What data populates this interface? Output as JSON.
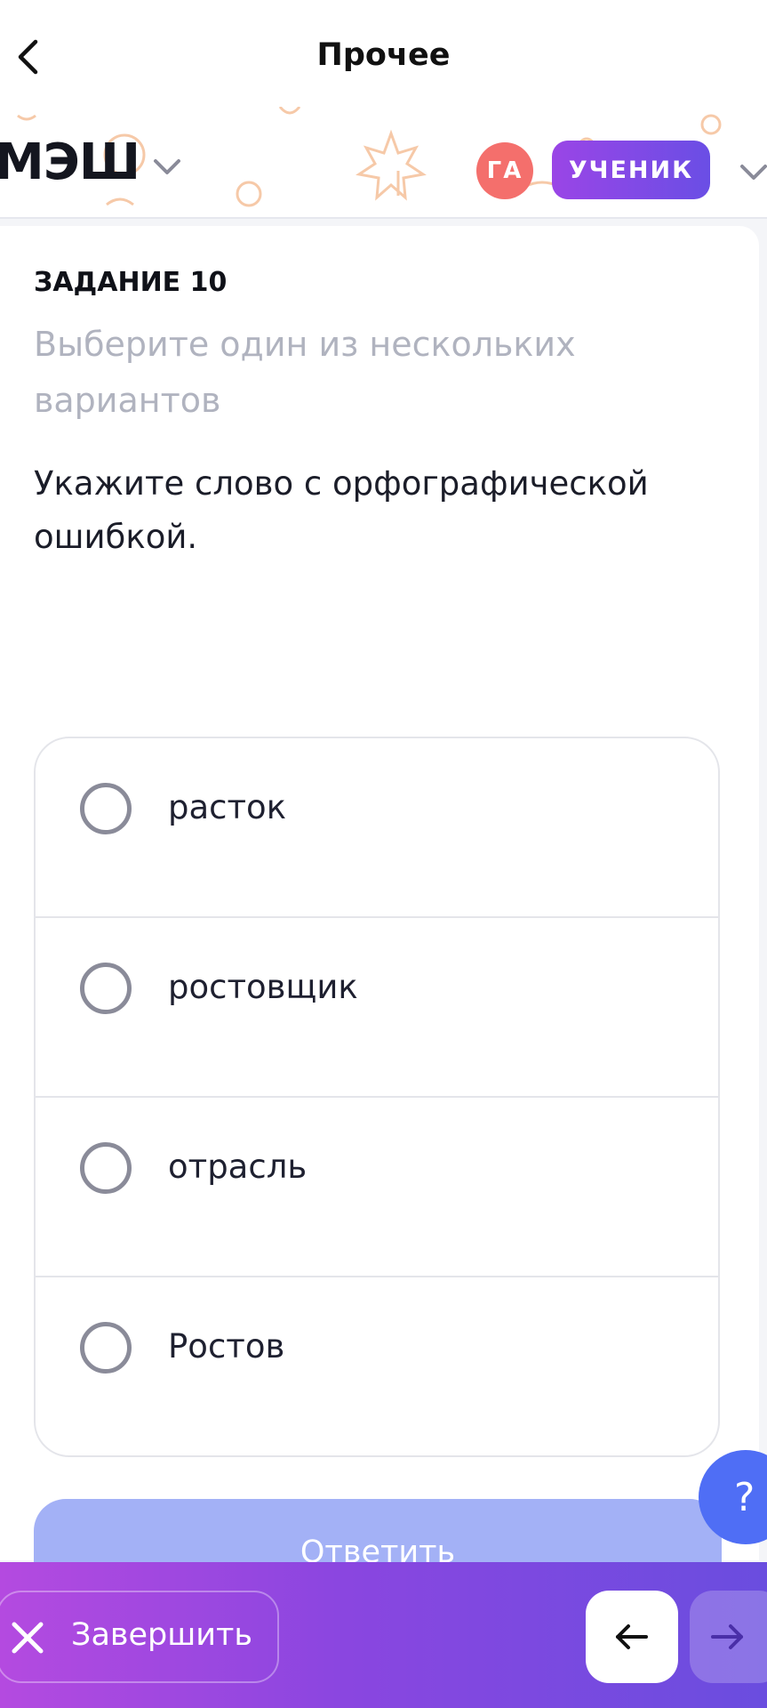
{
  "header": {
    "title": "Прочее",
    "back_icon": "chevron-left-icon"
  },
  "brand": {
    "logo_text": "МЭШ",
    "avatar_initials": "ГА",
    "role": "УЧЕНИК",
    "colors": {
      "avatar": "#f46f6c",
      "role_start": "#9a45e6",
      "role_end": "#6a4ee5"
    }
  },
  "task": {
    "label": "ЗАДАНИЕ 10",
    "hint": "Выберите один из нескольких вариантов",
    "question": "Укажите слово с орфографической ошибкой.",
    "options": [
      {
        "label": "расток",
        "selected": false
      },
      {
        "label": "ростовщик",
        "selected": false
      },
      {
        "label": "отрасль",
        "selected": false
      },
      {
        "label": "Ростов",
        "selected": false
      }
    ]
  },
  "actions": {
    "answer_label": "Ответить",
    "help_label": "?"
  },
  "footer": {
    "finish_label": "Завершить",
    "prev_icon": "arrow-left-icon",
    "next_icon": "arrow-right-icon"
  }
}
